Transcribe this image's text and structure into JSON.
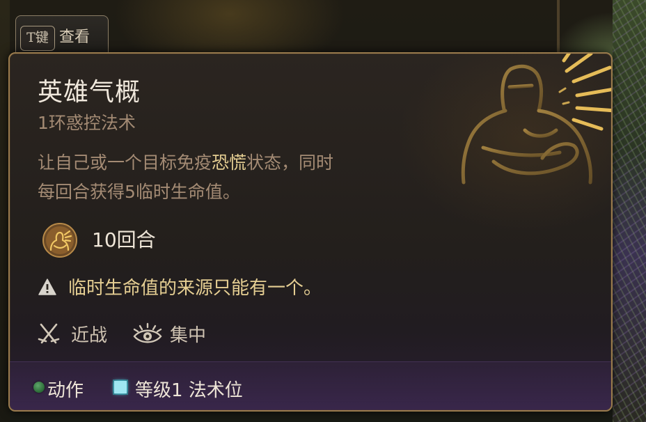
{
  "keybind": {
    "key": "T键",
    "label": "查看"
  },
  "spell": {
    "name": "英雄气概",
    "subtitle": "1环惑控法术",
    "description_part1": "让自己或一个目标免疫",
    "description_highlight": "恐慌",
    "description_part2": "状态，同时",
    "description_line2": "每回合获得5临时生命值。",
    "duration": "10回合",
    "warning": "临时生命值的来源只能有一个。",
    "properties": [
      {
        "icon": "crossed-swords-icon",
        "label": "近战"
      },
      {
        "icon": "concentration-eye-icon",
        "label": "集中"
      }
    ]
  },
  "resources": {
    "action_label": "动作",
    "action_color": "#3f8a4c",
    "slot_label": "等级1 法术位",
    "slot_color": "#9fe6f2"
  },
  "colors": {
    "accent_gold": "#e6cf93",
    "border": "#9a7b4d",
    "muted_text": "#a48b74"
  }
}
